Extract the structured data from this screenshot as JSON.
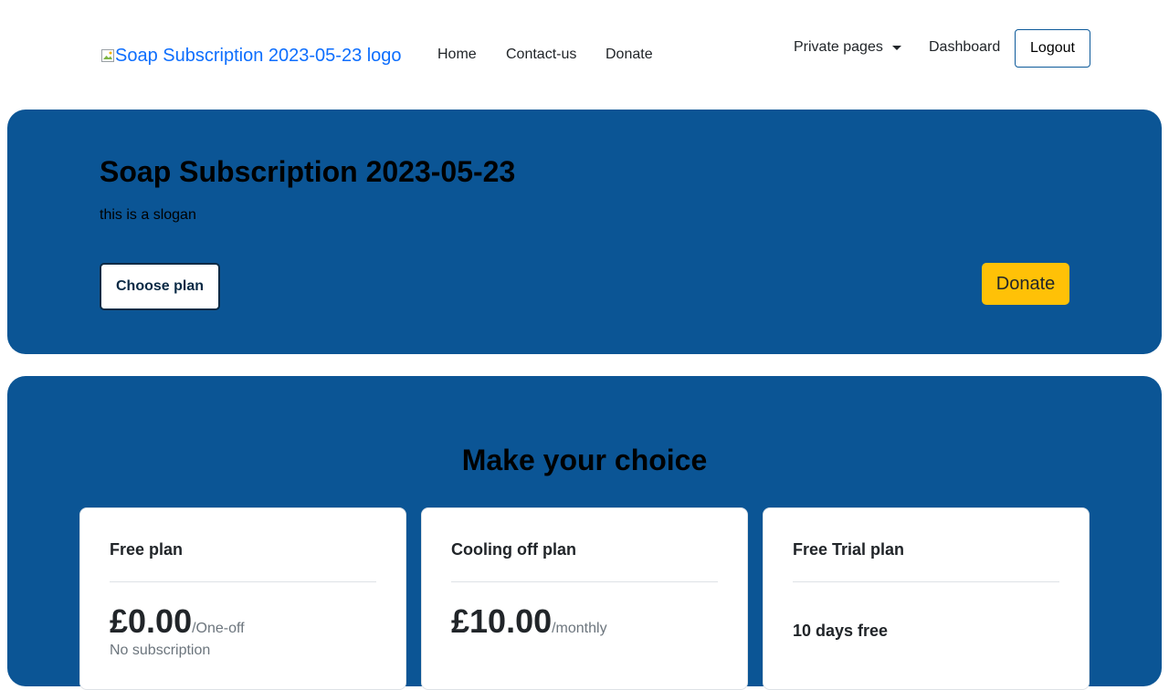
{
  "navbar": {
    "logo_alt": "Soap Subscription 2023-05-23 logo",
    "links": {
      "home": "Home",
      "contact": "Contact-us",
      "donate": "Donate",
      "private_pages": "Private pages",
      "dashboard": "Dashboard"
    },
    "logout_label": "Logout"
  },
  "hero": {
    "title": "Soap Subscription 2023-05-23",
    "slogan": "this is a slogan",
    "choose_plan_label": "Choose plan",
    "donate_label": "Donate"
  },
  "plans": {
    "title": "Make your choice",
    "cards": [
      {
        "name": "Free plan",
        "price": "£0.00",
        "period": "/One-off",
        "note": "No subscription"
      },
      {
        "name": "Cooling off plan",
        "price": "£10.00",
        "period": "/monthly"
      },
      {
        "name": "Free Trial plan",
        "trial": "10 days free"
      }
    ]
  },
  "colors": {
    "brand_blue": "#0b5595",
    "link_blue": "#0d6efd",
    "donate_yellow": "#ffc107"
  }
}
